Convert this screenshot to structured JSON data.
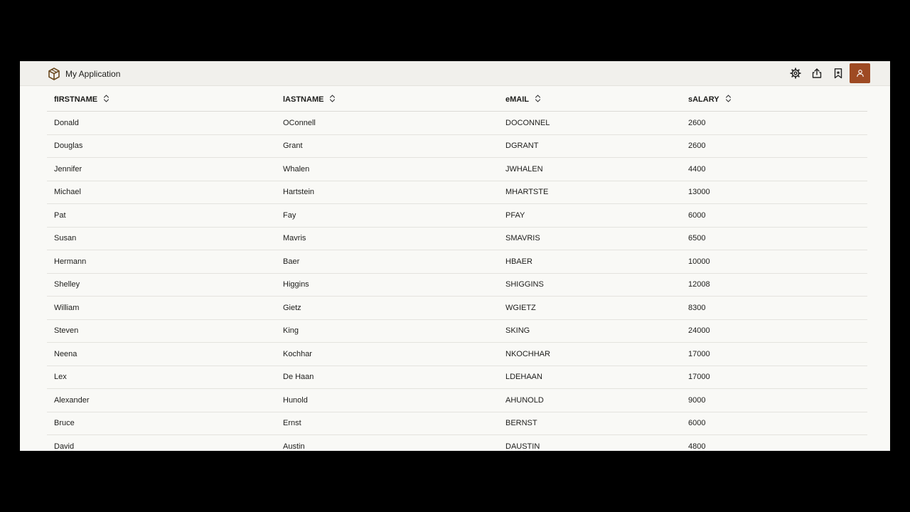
{
  "app": {
    "title": "My Application",
    "logo_icon": "cube-icon",
    "actions": [
      {
        "name": "settings-icon"
      },
      {
        "name": "share-icon"
      },
      {
        "name": "bookmark-icon"
      },
      {
        "name": "user-icon"
      }
    ],
    "avatar_color": "#9e4a23"
  },
  "table": {
    "columns": [
      "fIRSTNAME",
      "lASTNAME",
      "eMAIL",
      "sALARY"
    ],
    "rows": [
      [
        "Donald",
        "OConnell",
        "DOCONNEL",
        "2600"
      ],
      [
        "Douglas",
        "Grant",
        "DGRANT",
        "2600"
      ],
      [
        "Jennifer",
        "Whalen",
        "JWHALEN",
        "4400"
      ],
      [
        "Michael",
        "Hartstein",
        "MHARTSTE",
        "13000"
      ],
      [
        "Pat",
        "Fay",
        "PFAY",
        "6000"
      ],
      [
        "Susan",
        "Mavris",
        "SMAVRIS",
        "6500"
      ],
      [
        "Hermann",
        "Baer",
        "HBAER",
        "10000"
      ],
      [
        "Shelley",
        "Higgins",
        "SHIGGINS",
        "12008"
      ],
      [
        "William",
        "Gietz",
        "WGIETZ",
        "8300"
      ],
      [
        "Steven",
        "King",
        "SKING",
        "24000"
      ],
      [
        "Neena",
        "Kochhar",
        "NKOCHHAR",
        "17000"
      ],
      [
        "Lex",
        "De Haan",
        "LDEHAAN",
        "17000"
      ],
      [
        "Alexander",
        "Hunold",
        "AHUNOLD",
        "9000"
      ],
      [
        "Bruce",
        "Ernst",
        "BERNST",
        "6000"
      ],
      [
        "David",
        "Austin",
        "DAUSTIN",
        "4800"
      ]
    ]
  }
}
